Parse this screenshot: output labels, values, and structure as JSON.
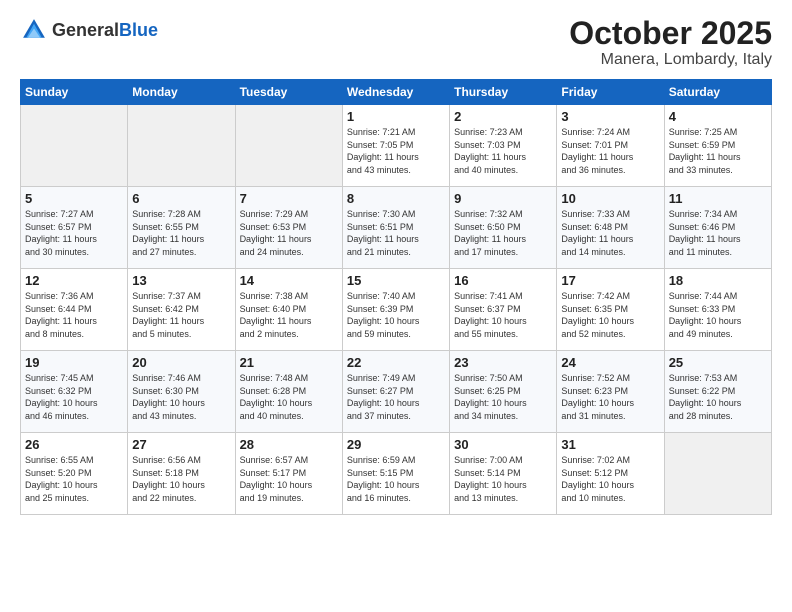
{
  "header": {
    "logo_general": "General",
    "logo_blue": "Blue",
    "month": "October 2025",
    "location": "Manera, Lombardy, Italy"
  },
  "days_of_week": [
    "Sunday",
    "Monday",
    "Tuesday",
    "Wednesday",
    "Thursday",
    "Friday",
    "Saturday"
  ],
  "weeks": [
    [
      {
        "day": "",
        "info": ""
      },
      {
        "day": "",
        "info": ""
      },
      {
        "day": "",
        "info": ""
      },
      {
        "day": "1",
        "info": "Sunrise: 7:21 AM\nSunset: 7:05 PM\nDaylight: 11 hours\nand 43 minutes."
      },
      {
        "day": "2",
        "info": "Sunrise: 7:23 AM\nSunset: 7:03 PM\nDaylight: 11 hours\nand 40 minutes."
      },
      {
        "day": "3",
        "info": "Sunrise: 7:24 AM\nSunset: 7:01 PM\nDaylight: 11 hours\nand 36 minutes."
      },
      {
        "day": "4",
        "info": "Sunrise: 7:25 AM\nSunset: 6:59 PM\nDaylight: 11 hours\nand 33 minutes."
      }
    ],
    [
      {
        "day": "5",
        "info": "Sunrise: 7:27 AM\nSunset: 6:57 PM\nDaylight: 11 hours\nand 30 minutes."
      },
      {
        "day": "6",
        "info": "Sunrise: 7:28 AM\nSunset: 6:55 PM\nDaylight: 11 hours\nand 27 minutes."
      },
      {
        "day": "7",
        "info": "Sunrise: 7:29 AM\nSunset: 6:53 PM\nDaylight: 11 hours\nand 24 minutes."
      },
      {
        "day": "8",
        "info": "Sunrise: 7:30 AM\nSunset: 6:51 PM\nDaylight: 11 hours\nand 21 minutes."
      },
      {
        "day": "9",
        "info": "Sunrise: 7:32 AM\nSunset: 6:50 PM\nDaylight: 11 hours\nand 17 minutes."
      },
      {
        "day": "10",
        "info": "Sunrise: 7:33 AM\nSunset: 6:48 PM\nDaylight: 11 hours\nand 14 minutes."
      },
      {
        "day": "11",
        "info": "Sunrise: 7:34 AM\nSunset: 6:46 PM\nDaylight: 11 hours\nand 11 minutes."
      }
    ],
    [
      {
        "day": "12",
        "info": "Sunrise: 7:36 AM\nSunset: 6:44 PM\nDaylight: 11 hours\nand 8 minutes."
      },
      {
        "day": "13",
        "info": "Sunrise: 7:37 AM\nSunset: 6:42 PM\nDaylight: 11 hours\nand 5 minutes."
      },
      {
        "day": "14",
        "info": "Sunrise: 7:38 AM\nSunset: 6:40 PM\nDaylight: 11 hours\nand 2 minutes."
      },
      {
        "day": "15",
        "info": "Sunrise: 7:40 AM\nSunset: 6:39 PM\nDaylight: 10 hours\nand 59 minutes."
      },
      {
        "day": "16",
        "info": "Sunrise: 7:41 AM\nSunset: 6:37 PM\nDaylight: 10 hours\nand 55 minutes."
      },
      {
        "day": "17",
        "info": "Sunrise: 7:42 AM\nSunset: 6:35 PM\nDaylight: 10 hours\nand 52 minutes."
      },
      {
        "day": "18",
        "info": "Sunrise: 7:44 AM\nSunset: 6:33 PM\nDaylight: 10 hours\nand 49 minutes."
      }
    ],
    [
      {
        "day": "19",
        "info": "Sunrise: 7:45 AM\nSunset: 6:32 PM\nDaylight: 10 hours\nand 46 minutes."
      },
      {
        "day": "20",
        "info": "Sunrise: 7:46 AM\nSunset: 6:30 PM\nDaylight: 10 hours\nand 43 minutes."
      },
      {
        "day": "21",
        "info": "Sunrise: 7:48 AM\nSunset: 6:28 PM\nDaylight: 10 hours\nand 40 minutes."
      },
      {
        "day": "22",
        "info": "Sunrise: 7:49 AM\nSunset: 6:27 PM\nDaylight: 10 hours\nand 37 minutes."
      },
      {
        "day": "23",
        "info": "Sunrise: 7:50 AM\nSunset: 6:25 PM\nDaylight: 10 hours\nand 34 minutes."
      },
      {
        "day": "24",
        "info": "Sunrise: 7:52 AM\nSunset: 6:23 PM\nDaylight: 10 hours\nand 31 minutes."
      },
      {
        "day": "25",
        "info": "Sunrise: 7:53 AM\nSunset: 6:22 PM\nDaylight: 10 hours\nand 28 minutes."
      }
    ],
    [
      {
        "day": "26",
        "info": "Sunrise: 6:55 AM\nSunset: 5:20 PM\nDaylight: 10 hours\nand 25 minutes."
      },
      {
        "day": "27",
        "info": "Sunrise: 6:56 AM\nSunset: 5:18 PM\nDaylight: 10 hours\nand 22 minutes."
      },
      {
        "day": "28",
        "info": "Sunrise: 6:57 AM\nSunset: 5:17 PM\nDaylight: 10 hours\nand 19 minutes."
      },
      {
        "day": "29",
        "info": "Sunrise: 6:59 AM\nSunset: 5:15 PM\nDaylight: 10 hours\nand 16 minutes."
      },
      {
        "day": "30",
        "info": "Sunrise: 7:00 AM\nSunset: 5:14 PM\nDaylight: 10 hours\nand 13 minutes."
      },
      {
        "day": "31",
        "info": "Sunrise: 7:02 AM\nSunset: 5:12 PM\nDaylight: 10 hours\nand 10 minutes."
      },
      {
        "day": "",
        "info": ""
      }
    ]
  ]
}
